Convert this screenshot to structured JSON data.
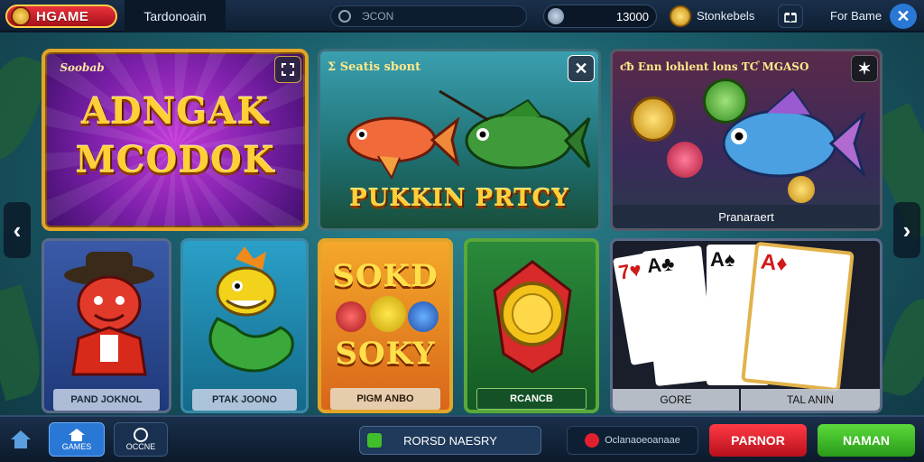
{
  "topbar": {
    "logo_text": "HGAME",
    "active_tab": "Tardonoain",
    "search_placeholder": "ЭCON",
    "balance": "13000",
    "stat_label": "Stonkebels",
    "right_label": "For Bame",
    "close_glyph": "✕"
  },
  "cards": {
    "featured": {
      "tag": "Soobab",
      "title_line1": "ADNGAK",
      "title_line2": "MCODOK"
    },
    "pumpkin": {
      "tag": "Ʃ Seatis sbont",
      "title": "PUKKIN PRTCY"
    },
    "fishcoins": {
      "tag": "ƈƀ Enn lohlent lons ƬƇ MGASO",
      "label": "Pranaraert"
    },
    "pirate": {
      "label": "PAND JOKNOL"
    },
    "seadragon": {
      "label": "PTAK JOONO"
    },
    "sokd": {
      "title_line1": "SOKD",
      "title_line2": "SOKY",
      "label": "PIGM ANBO"
    },
    "medal": {
      "label": "RCANCB"
    },
    "poker": {
      "label_left": "GORE",
      "label_right": "TAL ANIN"
    }
  },
  "bottombar": {
    "btn2": "GAMES",
    "btn3": "OCCNE",
    "center_btn": "RORSD NAESRY",
    "right_info": "Oclanaoeoanaae",
    "red_btn": "PARNOR",
    "green_btn": "NAMAN"
  },
  "colors": {
    "accent_gold": "#ffcf38",
    "red_button": "#e0202e",
    "green_button": "#3fbf2a",
    "topbar_bg": "#0f1f33"
  }
}
